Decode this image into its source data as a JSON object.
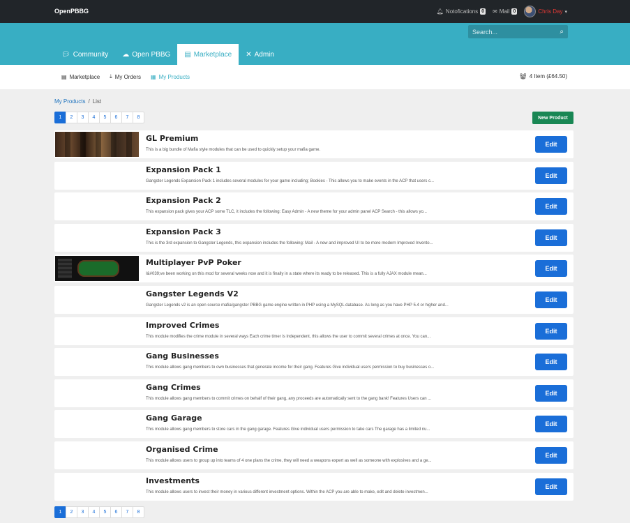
{
  "topbar": {
    "brand": "OpenPBBG",
    "notifications_label": "Notofications",
    "notifications_count": "0",
    "mail_label": "Mail",
    "mail_count": "0",
    "user_name": "Chris Day"
  },
  "search": {
    "placeholder": "Search..."
  },
  "nav": {
    "tabs": [
      {
        "label": "Community",
        "icon": "comments-icon"
      },
      {
        "label": "Open PBBG",
        "icon": "cloud-icon"
      },
      {
        "label": "Marketplace",
        "icon": "store-icon",
        "active": true
      },
      {
        "label": "Admin",
        "icon": "tools-icon"
      }
    ]
  },
  "subnav": {
    "items": [
      {
        "label": "Marketplace",
        "icon": "store-icon"
      },
      {
        "label": "My Orders",
        "icon": "download-icon"
      },
      {
        "label": "My Products",
        "icon": "boxes-icon",
        "active": true
      }
    ],
    "cart": "4 Item (£64.50)"
  },
  "breadcrumb": {
    "link": "My Products",
    "separator": "/",
    "current": "List"
  },
  "pagination": {
    "pages": [
      "1",
      "2",
      "3",
      "4",
      "5",
      "6",
      "7",
      "8"
    ],
    "active": "1"
  },
  "new_product_label": "New Product",
  "edit_label": "Edit",
  "products": [
    {
      "title": "GL Premium",
      "desc": "This is a big bundle of Mafia style modules that can be used to quickly setup your mafia game.",
      "thumb": "mafia"
    },
    {
      "title": "Expansion Pack 1",
      "desc": "Gangster Legends Expansion Pack 1 includes several modules for your game including; Bookies - This allows you to make events in the ACP that users c...",
      "thumb": ""
    },
    {
      "title": "Expansion Pack 2",
      "desc": "This expansion pack gives your ACP some TLC, it includes the following: Easy Admin -  A new theme for your admin panel ACP Search - this allows yo...",
      "thumb": ""
    },
    {
      "title": "Expansion Pack 3",
      "desc": "This is the 3rd expansion to Gangster Legends, this expansion includes the following: Mail - A new and improved UI to be more modern Improved Invento...",
      "thumb": ""
    },
    {
      "title": "Multiplayer PvP Poker",
      "desc": "I&#039;ve been working on this mod for several weeks now and it is finally in a state where its ready to be released. This is a fully AJAX module mean...",
      "thumb": "poker"
    },
    {
      "title": "Gangster Legends V2",
      "desc": "Gangster Legends v2 is an open source mafia/gangster PBBG game engine written in PHP using a MySQL database. As long as you have PHP 5.4 or higher and...",
      "thumb": ""
    },
    {
      "title": "Improved Crimes",
      "desc": "This module modifies the crime module in several ways Each crime timer is Independent, this allows the user to commit several crimes at once. You can...",
      "thumb": ""
    },
    {
      "title": "Gang Businesses",
      "desc": "This module allows gang members to own businesses that generate income for their gang. Features Give individual users permission to buy businesses o...",
      "thumb": ""
    },
    {
      "title": "Gang Crimes",
      "desc": "This module allows gang members to commit crimes on behalf of their gang, any proceeds are automatically sent to the gang bank! Features Users can ...",
      "thumb": ""
    },
    {
      "title": "Gang Garage",
      "desc": "This module allows gang members to store cars in the gang garage. Features Give individual users permission to take cars The garage has a limited nu...",
      "thumb": ""
    },
    {
      "title": "Organised Crime",
      "desc": "This module allows users to group up into teams of 4 one plans the crime, they will need a weapons expert as well as someone with explosives and a ge...",
      "thumb": ""
    },
    {
      "title": "Investments",
      "desc": "This module allows users to invest their money in various different investment options. Within the ACP you are able to make, edit and delete investmen...",
      "thumb": ""
    }
  ]
}
